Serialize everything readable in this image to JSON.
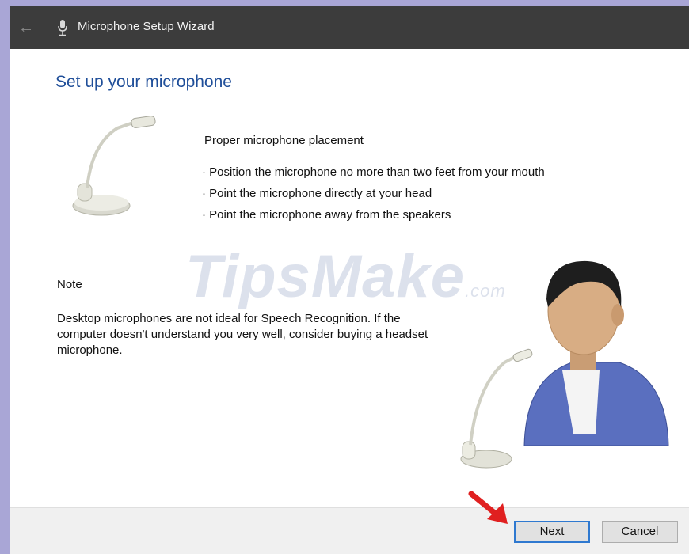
{
  "window": {
    "title": "Microphone Setup Wizard",
    "back_icon": "back-arrow-icon",
    "app_icon": "microphone-icon"
  },
  "page": {
    "heading": "Set up your microphone"
  },
  "placement": {
    "title": "Proper microphone placement",
    "items": [
      "· Position the microphone no more than two feet from your mouth",
      "· Point the microphone directly at your head",
      "· Point the microphone away from the speakers"
    ]
  },
  "note": {
    "title": "Note",
    "text": "Desktop microphones are not ideal for Speech Recognition. If the computer doesn't understand you very well, consider buying a headset microphone."
  },
  "watermark": {
    "brand": "TipsMake",
    "suffix": ".com"
  },
  "footer": {
    "next_label": "Next",
    "cancel_label": "Cancel"
  },
  "colors": {
    "titlebar": "#3c3c3c",
    "heading": "#1f4e99",
    "focus_border": "#2f79d0",
    "annotation_arrow": "#e02020"
  }
}
